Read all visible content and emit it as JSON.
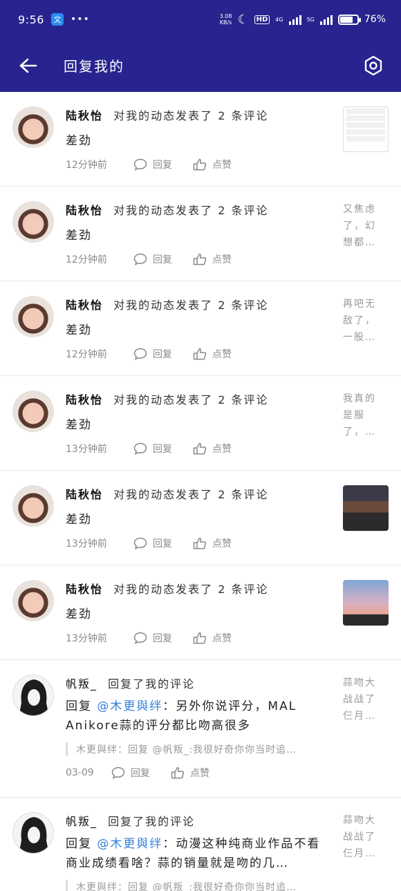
{
  "status_bar": {
    "time": "9:56",
    "app_icon": "文",
    "more": "•••",
    "speed_value": "3.08",
    "speed_unit": "KB/s",
    "hd": "HD",
    "net1": "4G",
    "net2": "5G",
    "battery_percent": "76%",
    "battery_level": 0.76
  },
  "navbar": {
    "title": "回复我的"
  },
  "items": [
    {
      "user": "陆秋怡",
      "action": "对我的动态发表了 2 条评论",
      "comment": "差劲",
      "time": "12分钟前",
      "reply": "回复",
      "like": "点赞",
      "side_type": "thumb-ui"
    },
    {
      "user": "陆秋怡",
      "action": "对我的动态发表了 2 条评论",
      "comment": "差劲",
      "time": "12分钟前",
      "reply": "回复",
      "like": "点赞",
      "side_text": "又焦虑了，幻想都…"
    },
    {
      "user": "陆秋怡",
      "action": "对我的动态发表了 2 条评论",
      "comment": "差劲",
      "time": "12分钟前",
      "reply": "回复",
      "like": "点赞",
      "side_text": "再吧无敌了，一股…"
    },
    {
      "user": "陆秋怡",
      "action": "对我的动态发表了 2 条评论",
      "comment": "差劲",
      "time": "13分钟前",
      "reply": "回复",
      "like": "点赞",
      "side_text": "我真的是服了，…"
    },
    {
      "user": "陆秋怡",
      "action": "对我的动态发表了 2 条评论",
      "comment": "差劲",
      "time": "13分钟前",
      "reply": "回复",
      "like": "点赞",
      "side_type": "thumb-game"
    },
    {
      "user": "陆秋怡",
      "action": "对我的动态发表了 2 条评论",
      "comment": "差劲",
      "time": "13分钟前",
      "reply": "回复",
      "like": "点赞",
      "side_type": "thumb-sunset"
    }
  ],
  "reply_items": [
    {
      "user": "帆叛_",
      "action": "回复了我的评论",
      "reply_prefix": "回复",
      "reply_to": "@木更與绊",
      "comment": "：另外你说评分，MAL Anikore蒜的评分都比吻高很多",
      "quote": "木更與绊：回复 @帆叛_:我很好奇你你当时追…",
      "time": "03-09",
      "reply": "回复",
      "like": "点赞",
      "side_text": "蒜吻大战战了仨月…"
    },
    {
      "user": "帆叛_",
      "action": "回复了我的评论",
      "reply_prefix": "回复",
      "reply_to": "@木更與绊",
      "comment": "：动漫这种纯商业作品不看商业成绩看啥？蒜的销量就是吻的几…",
      "quote": "木更與绊：回复 @帆叛_:我很好奇你你当时追…",
      "side_text": "蒜吻大战战了仨月…"
    }
  ]
}
